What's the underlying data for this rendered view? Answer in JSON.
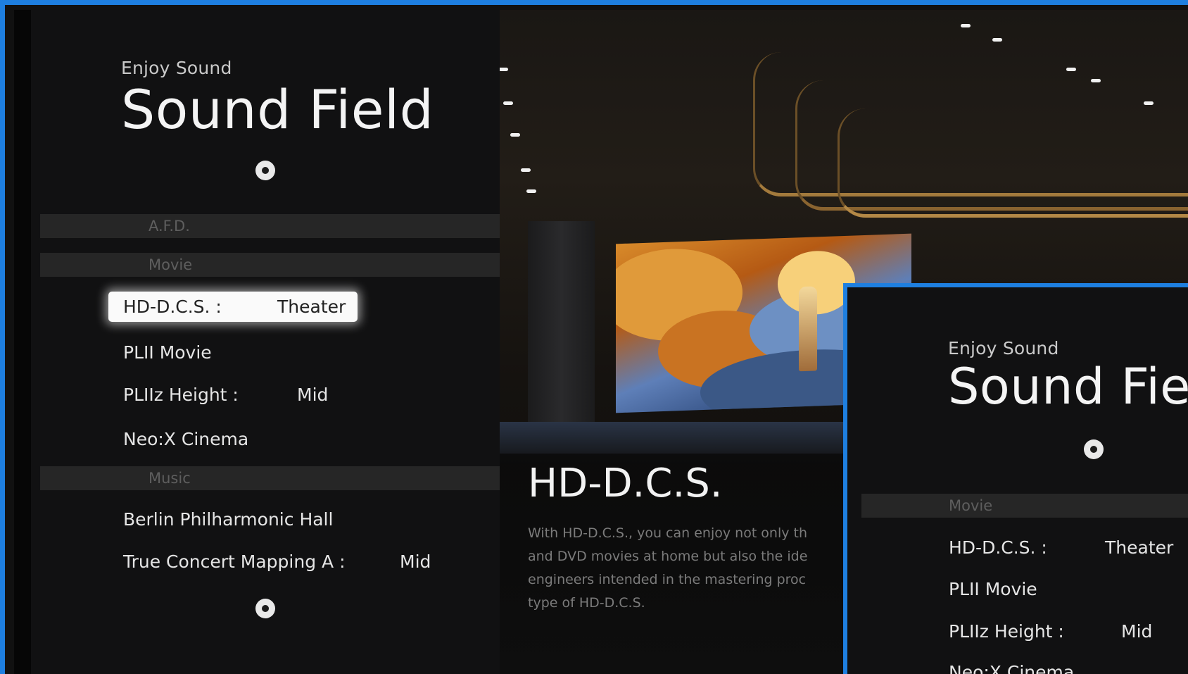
{
  "left_panel": {
    "subtitle": "Enjoy Sound",
    "title": "Sound Field",
    "categories": [
      "A.F.D.",
      "Movie",
      "Music"
    ],
    "items": [
      {
        "label": "HD-D.C.S. :",
        "value": "Theater"
      },
      {
        "label": "PLII Movie",
        "value": ""
      },
      {
        "label": "PLIIz Height :",
        "value": "Mid"
      },
      {
        "label": "Neo:X Cinema",
        "value": ""
      },
      {
        "label": "Berlin Philharmonic Hall",
        "value": ""
      },
      {
        "label": "True Concert Mapping A :",
        "value": "Mid"
      }
    ]
  },
  "feature": {
    "title": "HD-D.C.S.",
    "description_lines": [
      "With HD-D.C.S., you can enjoy not only th",
      "and DVD movies at home but also the ide",
      "engineers intended in the mastering proc",
      "type of HD-D.C.S."
    ]
  },
  "inset_panel": {
    "subtitle": "Enjoy Sound",
    "title": "Sound Fie",
    "category": "Movie",
    "items": [
      {
        "label": "HD-D.C.S. :",
        "value": "Theater"
      },
      {
        "label": "PLII Movie",
        "value": ""
      },
      {
        "label": "PLIIz Height :",
        "value": "Mid"
      },
      {
        "label": "Neo:X Cinema",
        "value": ""
      }
    ]
  },
  "colors": {
    "frame_border": "#1e7fe0",
    "panel_bg": "#111112",
    "category_bg": "#262626"
  }
}
